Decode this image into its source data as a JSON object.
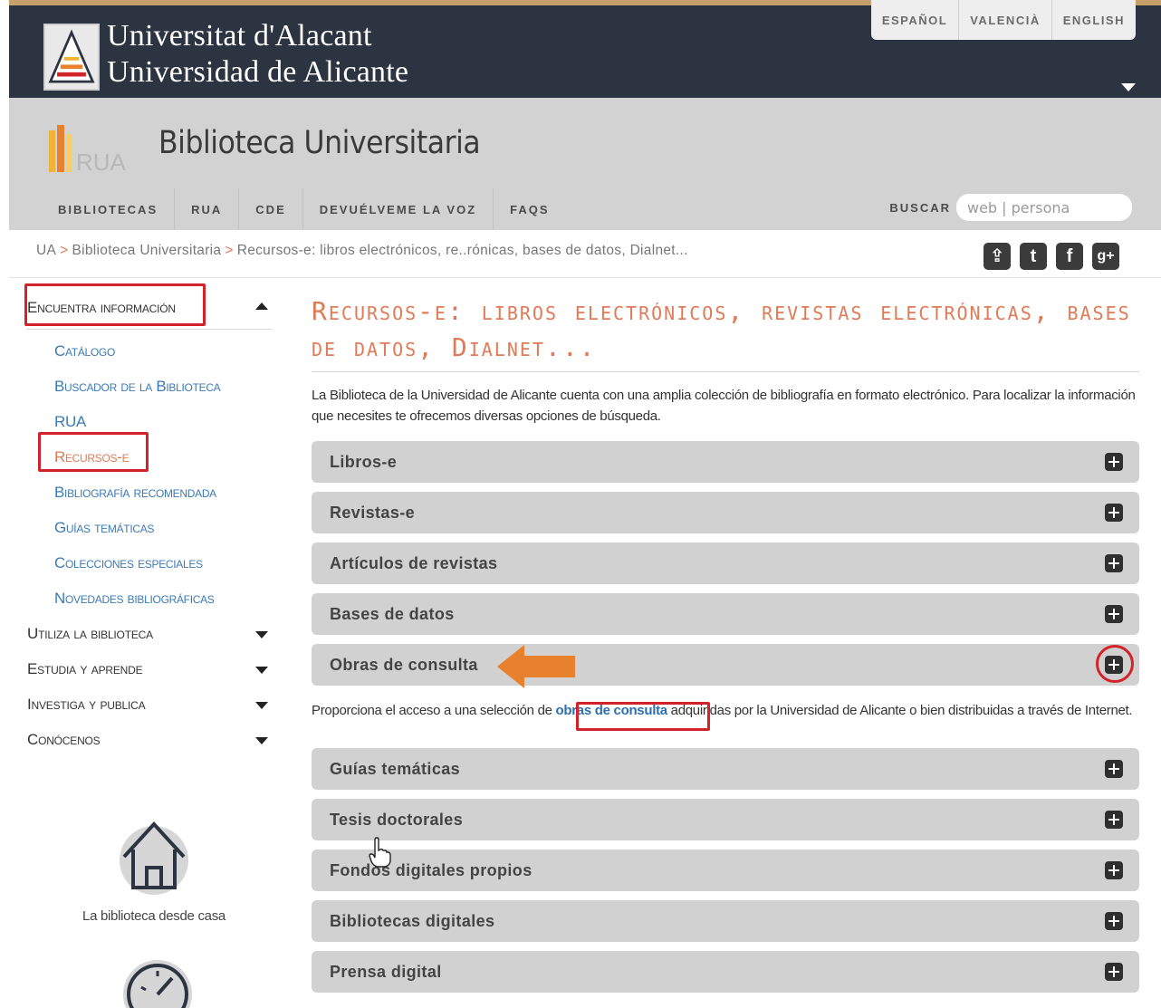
{
  "university": {
    "name_valencian": "Universitat d'Alacant",
    "name_spanish": "Universidad de Alicante",
    "languages": [
      "ESPAÑOL",
      "VALENCIÀ",
      "ENGLISH"
    ]
  },
  "library": {
    "logo_text": "RUA",
    "title": "Biblioteca Universitaria",
    "nav": [
      "BIBLIOTECAS",
      "RUA",
      "CDE",
      "DEVUÉLVEME LA VOZ",
      "FAQS"
    ],
    "search_label": "BUSCAR",
    "search_placeholder": "web | persona"
  },
  "breadcrumb": {
    "items": [
      "UA",
      "Biblioteca Universitaria",
      "Recursos-e: libros electrónicos, re..rónicas, bases de datos, Dialnet..."
    ],
    "separator": ">"
  },
  "social": {
    "icons": [
      "share-icon",
      "twitter-icon",
      "facebook-icon",
      "google-plus-icon"
    ],
    "glyphs": [
      "⇪",
      "t",
      "f",
      "g+"
    ]
  },
  "sidebar": {
    "sections": [
      {
        "label": "Encuentra información",
        "expanded": true,
        "items": [
          {
            "label": "Catálogo",
            "active": false
          },
          {
            "label": "Buscador de la Biblioteca",
            "active": false
          },
          {
            "label": "RUA",
            "active": false
          },
          {
            "label": "Recursos-e",
            "active": true
          },
          {
            "label": "Bibliografía recomendada",
            "active": false
          },
          {
            "label": "Guías temáticas",
            "active": false
          },
          {
            "label": "Colecciones especiales",
            "active": false
          },
          {
            "label": "Novedades bibliográficas",
            "active": false
          }
        ]
      },
      {
        "label": "Utiliza la biblioteca",
        "expanded": false
      },
      {
        "label": "Estudia y aprende",
        "expanded": false
      },
      {
        "label": "Investiga y publica",
        "expanded": false
      },
      {
        "label": "Conócenos",
        "expanded": false
      }
    ],
    "home_label": "La biblioteca desde casa"
  },
  "main": {
    "title": "Recursos-e: libros electrónicos, revistas electrónicas, bases de datos, Dialnet...",
    "intro": "La Biblioteca de la Universidad de Alicante cuenta con una amplia colección de bibliografía en formato electrónico. Para localizar la información que necesites te ofrecemos diversas opciones de búsqueda.",
    "accordion": [
      "Libros-e",
      "Revistas-e",
      "Artículos de revistas",
      "Bases de datos",
      "Obras de consulta",
      "Guías temáticas",
      "Tesis doctorales",
      "Fondos digitales propios",
      "Bibliotecas digitales",
      "Prensa digital"
    ],
    "expanded_desc": {
      "before": "Proporciona el acceso a una selección de ",
      "link": "obras de consulta",
      "after": " adquiridas por la Universidad de Alicante o bien distribuidas a través de Internet."
    }
  },
  "colors": {
    "header_dark": "#2b3440",
    "accent_orange": "#e07a57",
    "link_blue": "#3d7ab3",
    "highlight_red": "#d2232a",
    "arrow_orange": "#e8812e"
  }
}
